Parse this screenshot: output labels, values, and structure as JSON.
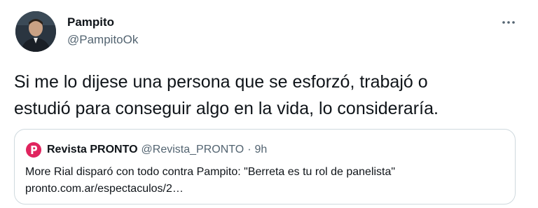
{
  "author": {
    "name": "Pampito",
    "handle": "@PampitoOk",
    "avatar": "avatar"
  },
  "more_icon": "more-horizontal-icon",
  "tweet": {
    "text": "Si me lo dijese una persona que se esforzó, trabajó o\nestudió para conseguir algo en la vida, lo consideraría."
  },
  "quoted": {
    "logo_icon": "pronto-logo-icon",
    "name": "Revista PRONTO",
    "handle": "@Revista_PRONTO",
    "separator": "·",
    "time": "9h",
    "text": "More Rial disparó con todo contra Pampito: \"Berreta es tu rol de panelista\"",
    "link": "pronto.com.ar/espectaculos/2…"
  },
  "colors": {
    "text": "#0f1419",
    "secondary": "#536471",
    "border": "#cfd9de",
    "logo": "#e0245e"
  }
}
